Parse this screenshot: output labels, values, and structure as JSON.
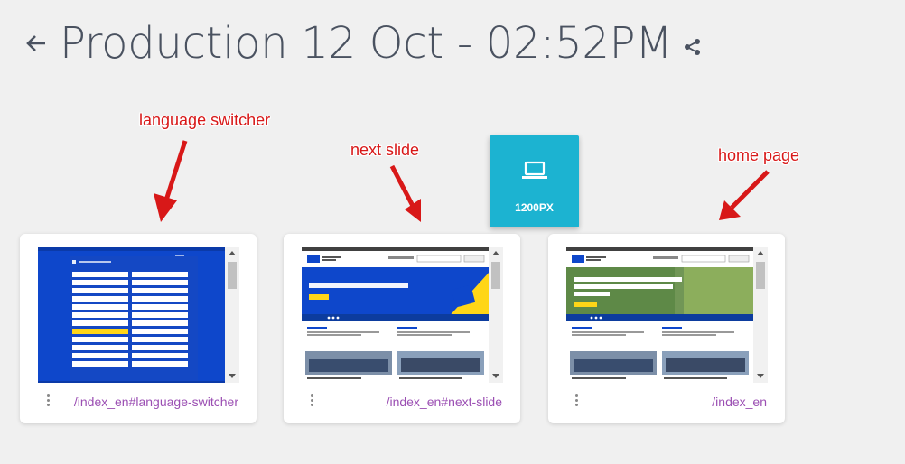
{
  "header": {
    "title": "Production 12 Oct - 02:52PM"
  },
  "annotations": {
    "language": "language switcher",
    "next": "next slide",
    "home": "home page"
  },
  "device": {
    "label": "1200PX",
    "icon": "laptop-icon"
  },
  "cards": [
    {
      "path": "/index_en#language-switcher"
    },
    {
      "path": "/index_en#next-slide"
    },
    {
      "path": "/index_en"
    }
  ],
  "colors": {
    "accent": "#1cb3d1",
    "annotation": "#d81818",
    "link": "#9b4fb3",
    "eu_blue": "#0e47cb"
  }
}
